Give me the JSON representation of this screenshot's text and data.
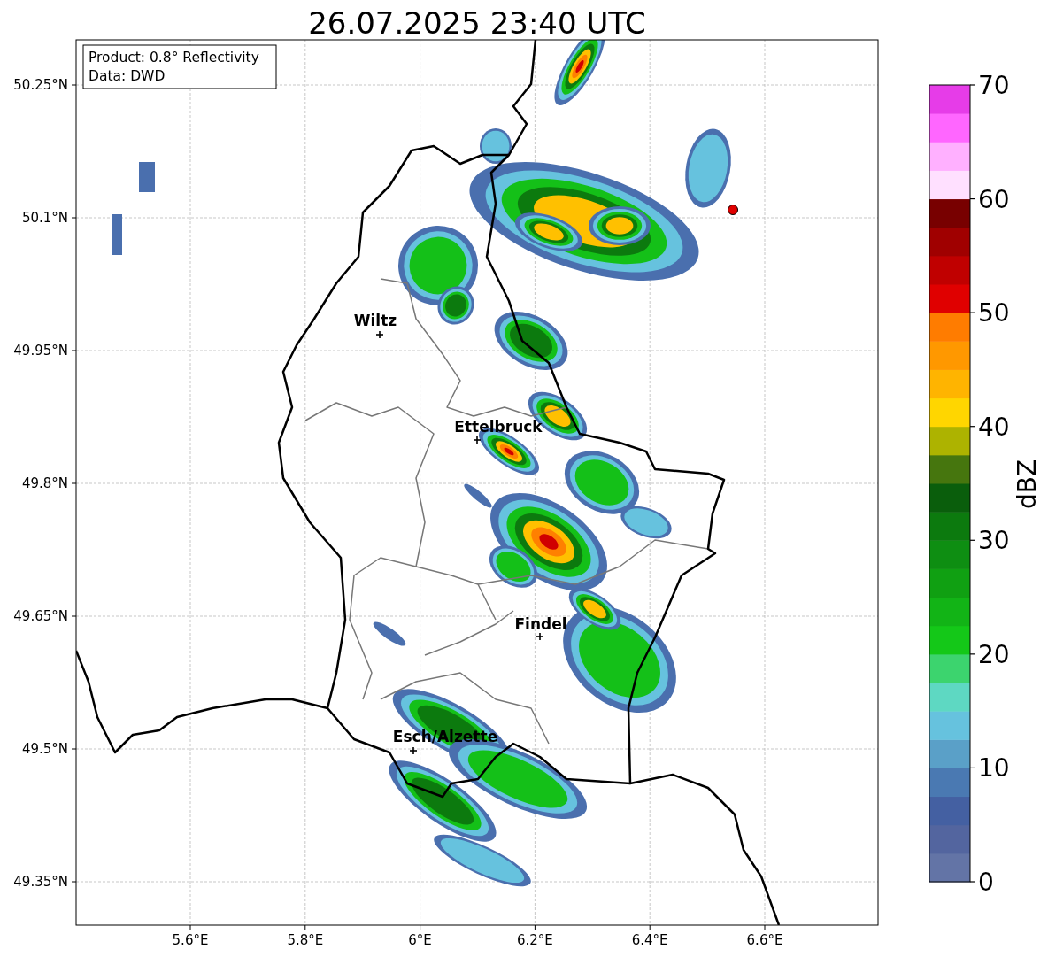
{
  "title": "26.07.2025 23:40 UTC",
  "info_box": {
    "product": "Product: 0.8° Reflectivity",
    "source": "Data: DWD"
  },
  "map": {
    "xticks": [
      "5.6°E",
      "5.8°E",
      "6°E",
      "6.2°E",
      "6.4°E",
      "6.6°E"
    ],
    "yticks": [
      "50.25°N",
      "50.1°N",
      "49.95°N",
      "49.8°N",
      "49.65°N",
      "49.5°N",
      "49.35°N"
    ],
    "cities": [
      {
        "name": "Wiltz"
      },
      {
        "name": "Ettelbruck"
      },
      {
        "name": "Findel"
      },
      {
        "name": "Esch/Alzette"
      }
    ]
  },
  "colorbar": {
    "label": "dBZ",
    "ticks": [
      "70",
      "60",
      "50",
      "40",
      "30",
      "20",
      "10",
      "0"
    ],
    "segments": [
      {
        "color": "#6374a6"
      },
      {
        "color": "#53659f"
      },
      {
        "color": "#4460a2"
      },
      {
        "color": "#4a79b2"
      },
      {
        "color": "#5aa0c8"
      },
      {
        "color": "#66c2de"
      },
      {
        "color": "#5ed8c2"
      },
      {
        "color": "#3cd46e"
      },
      {
        "color": "#14c818"
      },
      {
        "color": "#12b416"
      },
      {
        "color": "#10a012"
      },
      {
        "color": "#0e8e12"
      },
      {
        "color": "#0c7a0e"
      },
      {
        "color": "#0a5e0c"
      },
      {
        "color": "#46760e"
      },
      {
        "color": "#adb300"
      },
      {
        "color": "#ffd600"
      },
      {
        "color": "#ffb400"
      },
      {
        "color": "#ff9800"
      },
      {
        "color": "#ff7c00"
      },
      {
        "color": "#e00000"
      },
      {
        "color": "#c00000"
      },
      {
        "color": "#a00000"
      },
      {
        "color": "#780000"
      },
      {
        "color": "#ffe0ff"
      },
      {
        "color": "#ffb0ff"
      },
      {
        "color": "#ff66ff"
      },
      {
        "color": "#e63ce8"
      }
    ]
  }
}
